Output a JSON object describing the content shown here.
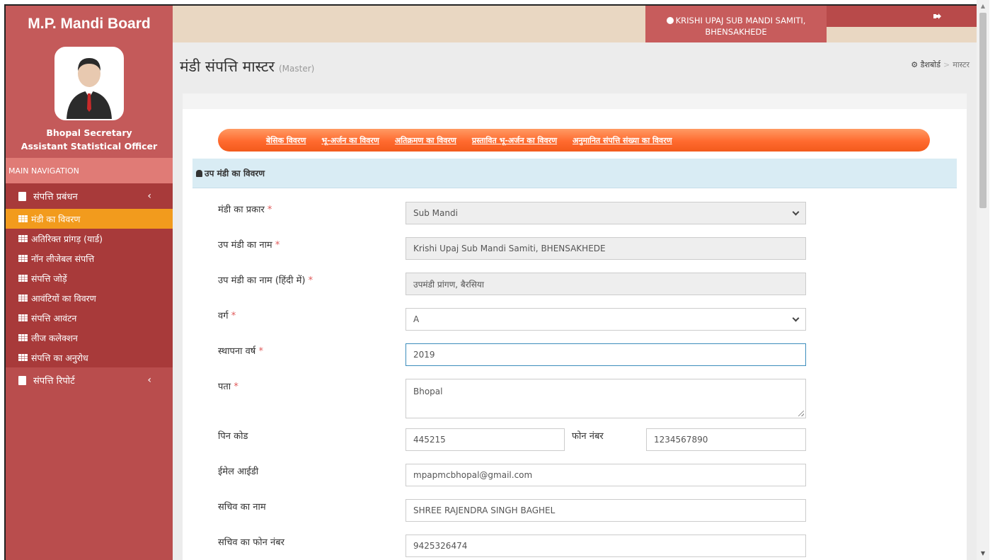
{
  "app": {
    "title": "M.P. Mandi Board"
  },
  "user": {
    "name": "Bhopal Secretary",
    "role": "Assistant Statistical Officer"
  },
  "nav": {
    "header": "MAIN NAVIGATION",
    "group1": {
      "label": "संपत्ति प्रबंधन"
    },
    "items": [
      {
        "label": "मंडी का विवरण"
      },
      {
        "label": "अतिरिक्त प्रांगड़ (यार्ड)"
      },
      {
        "label": "नॉन लीजेबल संपत्ति"
      },
      {
        "label": "संपत्ति जोड़ें"
      },
      {
        "label": "आवंटियों का विवरण"
      },
      {
        "label": "संपत्ति आवंटन"
      },
      {
        "label": "लीज कलेक्शन"
      },
      {
        "label": "संपत्ति का अनुरोध"
      }
    ],
    "group2": {
      "label": "संपत्ति रिपोर्ट"
    }
  },
  "topbar": {
    "location_line1": "KRISHI UPAJ SUB MANDI SAMITI,",
    "location_line2": "BHENSAKHEDE"
  },
  "page": {
    "title": "मंडी संपत्ति मास्टर",
    "subtitle": "(Master)"
  },
  "breadcrumb": {
    "home": "डैशबोर्ड",
    "current": "मास्टर"
  },
  "tabs": [
    {
      "label": "बेसिक विवरण"
    },
    {
      "label": "भू-अर्जन का विवरण"
    },
    {
      "label": "अतिक्रमण का विवरण"
    },
    {
      "label": "प्रस्तावित भू-अर्जन का विवरण"
    },
    {
      "label": "अनुमानित संपत्ति संख्या का विवरण"
    }
  ],
  "panel": {
    "title": "उप मंडी का विवरण"
  },
  "form": {
    "mandi_type": {
      "label": "मंडी का प्रकार",
      "value": "Sub Mandi"
    },
    "sub_mandi_name": {
      "label": "उप मंडी का नाम",
      "value": "Krishi Upaj Sub Mandi Samiti, BHENSAKHEDE"
    },
    "sub_mandi_name_hi": {
      "label": "उप मंडी का नाम (हिंदी में)",
      "value": "उपमंडी प्रांगण, बैरसिया"
    },
    "category": {
      "label": "वर्ग",
      "value": "A"
    },
    "established_year": {
      "label": "स्थापना वर्ष",
      "value": "2019"
    },
    "address": {
      "label": "पता",
      "value": "Bhopal"
    },
    "pincode": {
      "label": "पिन कोड",
      "value": "445215"
    },
    "phone": {
      "label": "फोन नंबर",
      "value": "1234567890"
    },
    "email": {
      "label": "ईमेल आईडी",
      "value": "mpapmcbhopal@gmail.com"
    },
    "secretary_name": {
      "label": "सचिव का नाम",
      "value": "SHREE RAJENDRA SINGH BAGHEL"
    },
    "secretary_phone": {
      "label": "सचिव का फोन नंबर",
      "value": "9425326474"
    },
    "required_mark": "*"
  },
  "colors": {
    "sidebar": "#b94d4d",
    "active": "#f29b1d",
    "tabbar": "#ff6a2f",
    "panel_head": "#d9ecf4"
  }
}
